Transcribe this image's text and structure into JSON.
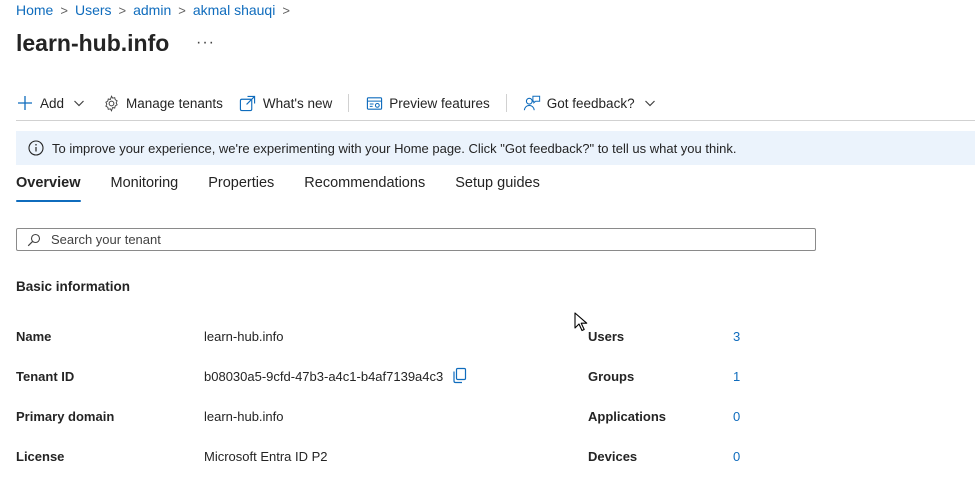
{
  "breadcrumb": [
    {
      "label": "Home"
    },
    {
      "label": "Users"
    },
    {
      "label": "admin"
    },
    {
      "label": "akmal shauqi"
    }
  ],
  "page": {
    "title": "learn-hub.info",
    "more": "···"
  },
  "toolbar": {
    "add": "Add",
    "manage_tenants": "Manage tenants",
    "whats_new": "What's new",
    "preview_features": "Preview features",
    "got_feedback": "Got feedback?"
  },
  "banner": {
    "text": "To improve your experience, we're experimenting with your Home page. Click \"Got feedback?\" to tell us what you think."
  },
  "tabs": [
    {
      "label": "Overview",
      "active": true
    },
    {
      "label": "Monitoring"
    },
    {
      "label": "Properties"
    },
    {
      "label": "Recommendations"
    },
    {
      "label": "Setup guides"
    }
  ],
  "search": {
    "placeholder": "Search your tenant"
  },
  "basic_info": {
    "title": "Basic information",
    "rows": [
      {
        "label": "Name",
        "value": "learn-hub.info"
      },
      {
        "label": "Tenant ID",
        "value": "b08030a5-9cfd-47b3-a4c1-b4af7139a4c3"
      },
      {
        "label": "Primary domain",
        "value": "learn-hub.info"
      },
      {
        "label": "License",
        "value": "Microsoft Entra ID P2"
      }
    ],
    "stats": [
      {
        "label": "Users",
        "value": "3"
      },
      {
        "label": "Groups",
        "value": "1"
      },
      {
        "label": "Applications",
        "value": "0"
      },
      {
        "label": "Devices",
        "value": "0"
      }
    ]
  },
  "colors": {
    "accent": "#0f6cbd",
    "banner_bg": "#ebf3fc",
    "text": "#242424"
  }
}
